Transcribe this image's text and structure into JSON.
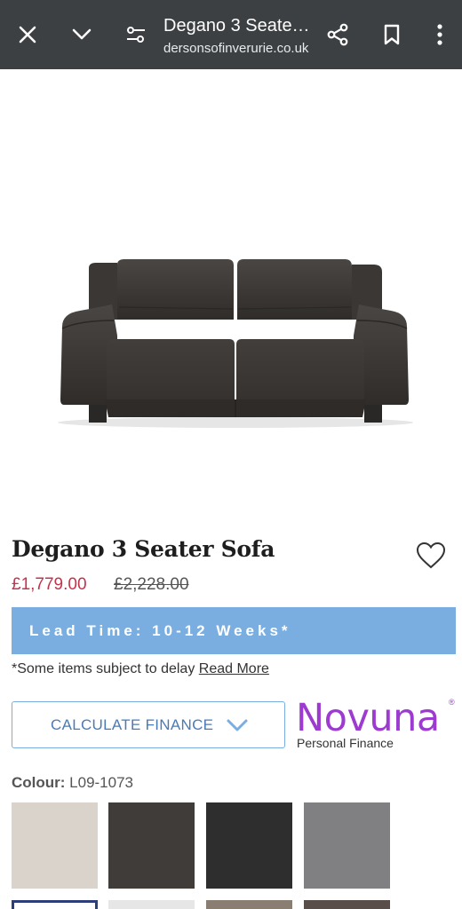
{
  "browser": {
    "title": "Degano 3 Seate…",
    "url": "dersonsofinverurie.co.uk",
    "icons": [
      "close-icon",
      "chevron-down-icon",
      "site-settings-icon",
      "share-icon",
      "bookmark-icon",
      "more-vert-icon"
    ]
  },
  "product": {
    "title": "Degano 3 Seater Sofa",
    "price_now": "£1,779.00",
    "price_was": "£2,228.00",
    "lead_time": "Lead Time: 10-12 Weeks*",
    "note_text": "*Some items subject to delay ",
    "note_link": "Read More"
  },
  "finance": {
    "button_label": "CALCULATE FINANCE",
    "brand": "Novuna",
    "brand_mark": "®",
    "brand_sub": "Personal Finance"
  },
  "colour": {
    "label": "Colour:",
    "value": " L09-1073",
    "swatches": [
      "#d9d3cb",
      "#3f3c39",
      "#2e2e2e",
      "#808083"
    ],
    "row2_colors": [
      "#2b3e7a",
      "#e6e6e6",
      "#8a7d72",
      "#5a4e4a"
    ]
  },
  "colors": {
    "accent_blue": "#7aaee0",
    "price_red": "#c2334c",
    "brand_purple": "#9d3bd1",
    "topbar": "#3c4043"
  }
}
